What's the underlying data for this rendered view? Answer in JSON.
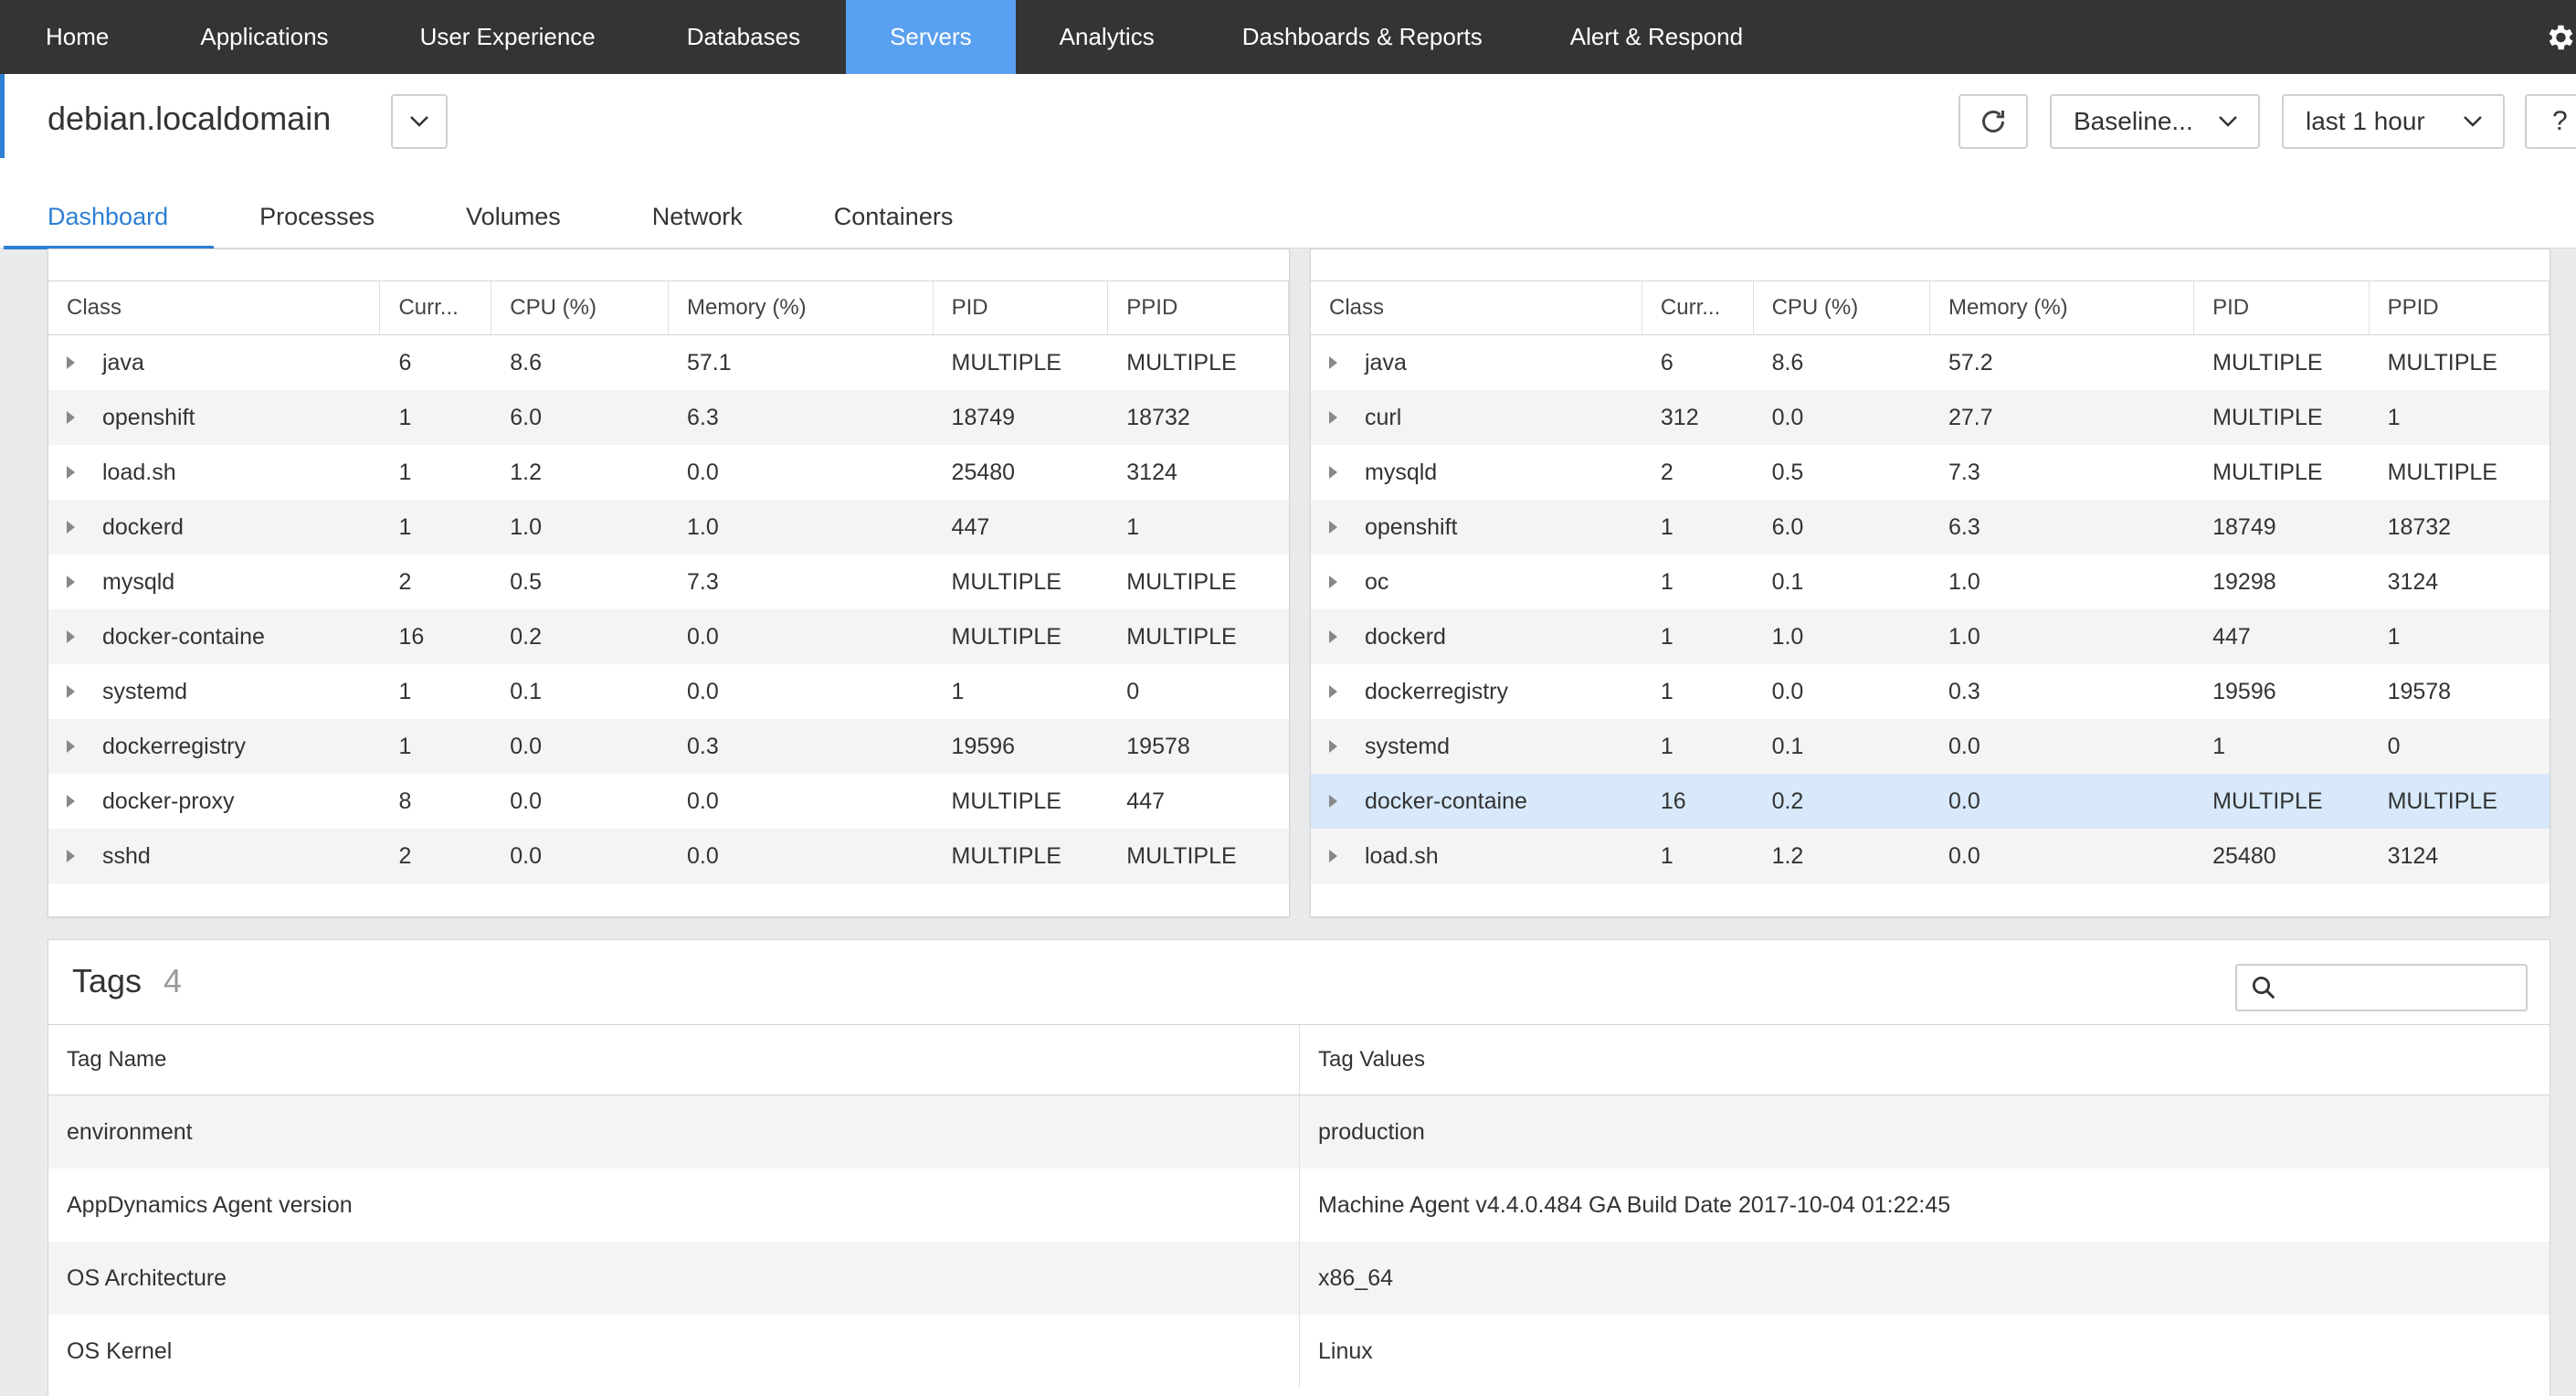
{
  "nav": {
    "items": [
      "Home",
      "Applications",
      "User Experience",
      "Databases",
      "Servers",
      "Analytics",
      "Dashboards & Reports",
      "Alert & Respond"
    ],
    "active_index": 4
  },
  "header": {
    "server_name": "debian.localdomain",
    "baseline_label": "Baseline...",
    "time_range_label": "last 1 hour",
    "help_label": "?"
  },
  "tabs": [
    "Dashboard",
    "Processes",
    "Volumes",
    "Network",
    "Containers"
  ],
  "left_table": {
    "columns": [
      "Class",
      "Curr...",
      "CPU (%)",
      "Memory (%)",
      "PID",
      "PPID"
    ],
    "rows": [
      [
        "java",
        "6",
        "8.6",
        "57.1",
        "MULTIPLE",
        "MULTIPLE"
      ],
      [
        "openshift",
        "1",
        "6.0",
        "6.3",
        "18749",
        "18732"
      ],
      [
        "load.sh",
        "1",
        "1.2",
        "0.0",
        "25480",
        "3124"
      ],
      [
        "dockerd",
        "1",
        "1.0",
        "1.0",
        "447",
        "1"
      ],
      [
        "mysqld",
        "2",
        "0.5",
        "7.3",
        "MULTIPLE",
        "MULTIPLE"
      ],
      [
        "docker-containe",
        "16",
        "0.2",
        "0.0",
        "MULTIPLE",
        "MULTIPLE"
      ],
      [
        "systemd",
        "1",
        "0.1",
        "0.0",
        "1",
        "0"
      ],
      [
        "dockerregistry",
        "1",
        "0.0",
        "0.3",
        "19596",
        "19578"
      ],
      [
        "docker-proxy",
        "8",
        "0.0",
        "0.0",
        "MULTIPLE",
        "447"
      ],
      [
        "sshd",
        "2",
        "0.0",
        "0.0",
        "MULTIPLE",
        "MULTIPLE"
      ]
    ]
  },
  "right_table": {
    "columns": [
      "Class",
      "Curr...",
      "CPU (%)",
      "Memory (%)",
      "PID",
      "PPID"
    ],
    "selected_index": 8,
    "rows": [
      [
        "java",
        "6",
        "8.6",
        "57.2",
        "MULTIPLE",
        "MULTIPLE"
      ],
      [
        "curl",
        "312",
        "0.0",
        "27.7",
        "MULTIPLE",
        "1"
      ],
      [
        "mysqld",
        "2",
        "0.5",
        "7.3",
        "MULTIPLE",
        "MULTIPLE"
      ],
      [
        "openshift",
        "1",
        "6.0",
        "6.3",
        "18749",
        "18732"
      ],
      [
        "oc",
        "1",
        "0.1",
        "1.0",
        "19298",
        "3124"
      ],
      [
        "dockerd",
        "1",
        "1.0",
        "1.0",
        "447",
        "1"
      ],
      [
        "dockerregistry",
        "1",
        "0.0",
        "0.3",
        "19596",
        "19578"
      ],
      [
        "systemd",
        "1",
        "0.1",
        "0.0",
        "1",
        "0"
      ],
      [
        "docker-containe",
        "16",
        "0.2",
        "0.0",
        "MULTIPLE",
        "MULTIPLE"
      ],
      [
        "load.sh",
        "1",
        "1.2",
        "0.0",
        "25480",
        "3124"
      ]
    ]
  },
  "tags": {
    "title": "Tags",
    "count": "4",
    "columns": [
      "Tag Name",
      "Tag Values"
    ],
    "rows": [
      [
        "environment",
        "production"
      ],
      [
        "AppDynamics Agent version",
        "Machine Agent v4.4.0.484 GA Build Date 2017-10-04 01:22:45"
      ],
      [
        "OS Architecture",
        "x86_64"
      ],
      [
        "OS Kernel",
        "Linux"
      ]
    ]
  },
  "colors": {
    "nav_bg": "#343434",
    "nav_active": "#5aa0f0",
    "accent": "#2d7fd3",
    "selected_row": "#d7e9fa"
  }
}
